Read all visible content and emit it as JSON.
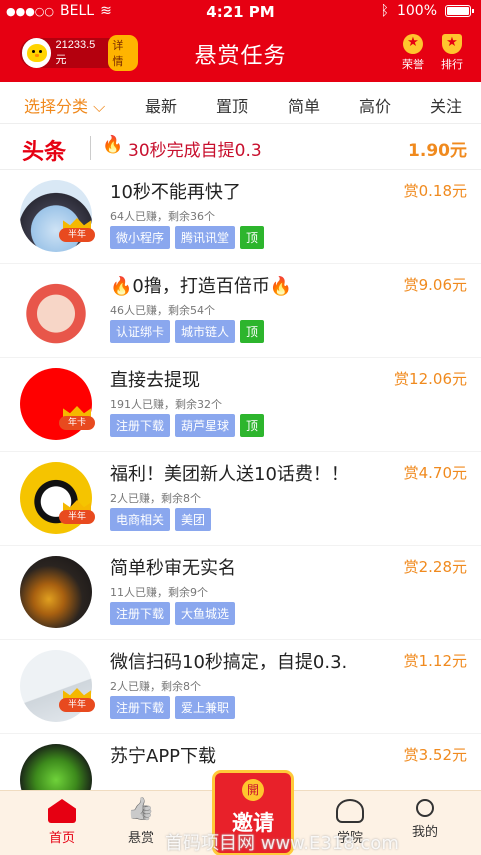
{
  "status": {
    "carrier": "BELL",
    "time": "4:21 PM",
    "battery": "100%"
  },
  "header": {
    "coins": "21233.5元",
    "detail": "详情",
    "title": "悬赏任务",
    "honor": "荣誉",
    "rank": "排行"
  },
  "filters": [
    {
      "label": "选择分类",
      "active": true
    },
    {
      "label": "最新"
    },
    {
      "label": "置顶"
    },
    {
      "label": "简单"
    },
    {
      "label": "高价"
    },
    {
      "label": "关注"
    }
  ],
  "headline": {
    "tag": "头条",
    "text": "30秒完成自提0.3",
    "price": "1.90元"
  },
  "tasks": [
    {
      "title": "10秒不能再快了",
      "meta": "64人已赚，剩余36个",
      "tags": [
        "微小程序",
        "腾讯讯堂",
        "顶"
      ],
      "reward": "赏0.18元",
      "badge": "半年"
    },
    {
      "title": "🔥0撸，打造百倍币🔥",
      "meta": "46人已赚，剩余54个",
      "tags": [
        "认证绑卡",
        "城市链人",
        "顶"
      ],
      "reward": "赏9.06元",
      "badge": ""
    },
    {
      "title": "直接去提现",
      "meta": "191人已赚，剩余32个",
      "tags": [
        "注册下载",
        "葫芦星球",
        "顶"
      ],
      "reward": "赏12.06元",
      "badge": "年卡"
    },
    {
      "title": "福利！美团新人送10话费！！",
      "meta": "2人已赚，剩余8个",
      "tags": [
        "电商相关",
        "美团"
      ],
      "reward": "赏4.70元",
      "badge": "半年"
    },
    {
      "title": "简单秒审无实名",
      "meta": "11人已赚，剩余9个",
      "tags": [
        "注册下载",
        "大鱼城选"
      ],
      "reward": "赏2.28元",
      "badge": ""
    },
    {
      "title": "微信扫码10秒搞定，自提0.3.",
      "meta": "2人已赚，剩余8个",
      "tags": [
        "注册下载",
        "爱上兼职"
      ],
      "reward": "赏1.12元",
      "badge": "半年"
    },
    {
      "title": "苏宁APP下载",
      "meta": "",
      "tags": [],
      "reward": "赏3.52元",
      "badge": ""
    }
  ],
  "tabs": {
    "home": "首页",
    "reward": "悬赏",
    "invite": "邀请",
    "invite_coin": "開",
    "school": "学院",
    "me": "我的"
  },
  "watermark": "首码项目网  www.E318.com",
  "colors": {
    "brand": "#e60012",
    "accent": "#f08a1e",
    "tag": "#8aa7ee",
    "top_tag": "#2db52d"
  }
}
